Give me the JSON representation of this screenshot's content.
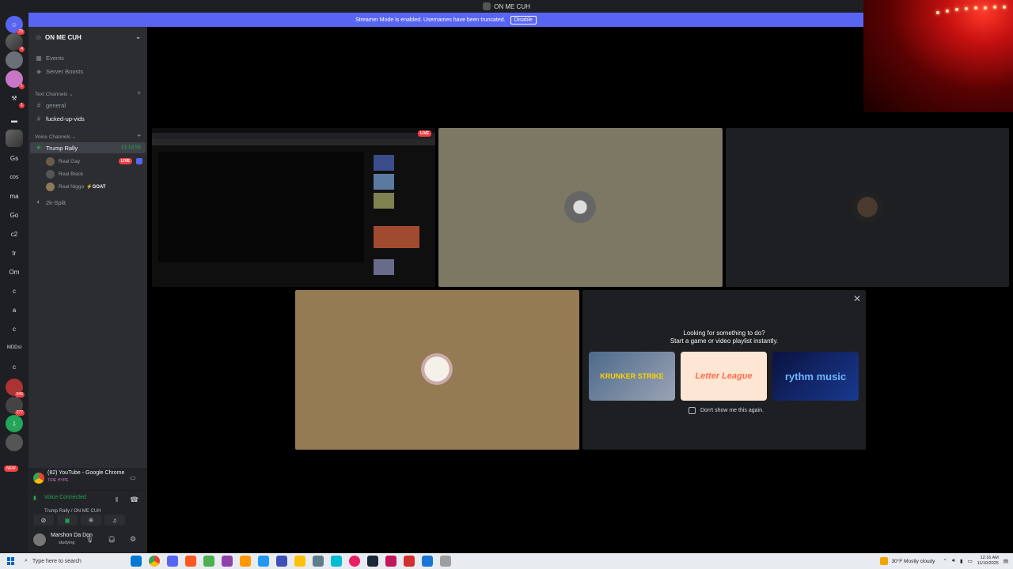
{
  "window": {
    "title": "ON ME CUH"
  },
  "banner": {
    "text": "Streamer Mode is enabled. Usernames have been truncated.",
    "button": "Disable"
  },
  "server_list": {
    "badges": {
      "home": "23",
      "s1": "4",
      "s2": "1",
      "s3": "1",
      "s9": "946",
      "s10": "277",
      "new": "NEW"
    },
    "text_servers": [
      "Gs",
      "cos",
      "ma",
      "Go",
      "c2",
      "tr",
      "Om",
      "c",
      "a",
      "c",
      "MDDsI",
      "c"
    ]
  },
  "guild": {
    "name": "ON ME CUH"
  },
  "channels": {
    "events": "Events",
    "boosts": "Server Boosts",
    "text_category": "Text Channels",
    "text": [
      "general",
      "fucked-up-vids"
    ],
    "voice_category": "Voice Channels",
    "voice_active": "Trump Rally",
    "voice_timer": "13:18:55",
    "voice_users": [
      {
        "name": "Real Gay",
        "tag": "LIVE"
      },
      {
        "name": "Real Black",
        "tag": ""
      },
      {
        "name": "Real Nigga",
        "tag": "⚡GOAT"
      }
    ],
    "voice_other": "2k-Split"
  },
  "activity_panel": {
    "title": "(82) YouTube - Google Chrome",
    "sub": "TIDE HYPE"
  },
  "voice_panel": {
    "status": "Voice Connected",
    "location": "Trump Rally / ON ME CUH"
  },
  "user_panel": {
    "name": "Marshon Da Don",
    "status": "studying"
  },
  "stage": {
    "live_label": "LIVE",
    "activity_heading": "Looking for something to do?",
    "activity_sub": "Start a game or video playlist instantly.",
    "games": [
      "KRUNKER STRIKE",
      "Letter League",
      "rythm music"
    ],
    "dont_show": "Don't show me this again."
  },
  "taskbar": {
    "search_placeholder": "Type here to search",
    "weather": "30°F  Mostly cloudy",
    "time": "12:16 AM",
    "date": "11/10/2025"
  },
  "colors": {
    "blurple": "#5865f2",
    "green": "#23a55a",
    "red": "#f23f43"
  }
}
